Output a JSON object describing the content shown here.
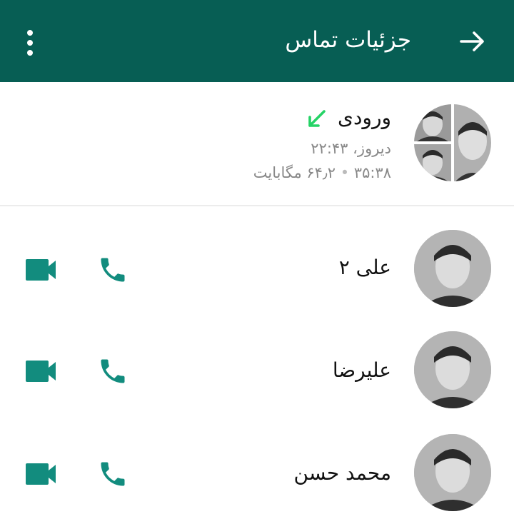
{
  "header": {
    "title": "جزئیات تماس",
    "back_icon": "arrow-right-icon",
    "menu_icon": "more-vert-icon",
    "background_color": "#075e54"
  },
  "call_summary": {
    "type_label": "ورودی",
    "direction_icon": "incoming-call-arrow-icon",
    "time": "دیروز، ۲۲:۴۳",
    "duration": "۳۵:۳۸",
    "size": "۶۴٫۲ مگابایت",
    "accent_color": "#25d366"
  },
  "participants": [
    {
      "name": "علی ۲",
      "video_icon": "videocam-icon",
      "voice_icon": "phone-icon"
    },
    {
      "name": "علیرضا",
      "video_icon": "videocam-icon",
      "voice_icon": "phone-icon"
    },
    {
      "name": "محمد حسن",
      "video_icon": "videocam-icon",
      "voice_icon": "phone-icon"
    }
  ],
  "icon_color": "#128c7e"
}
